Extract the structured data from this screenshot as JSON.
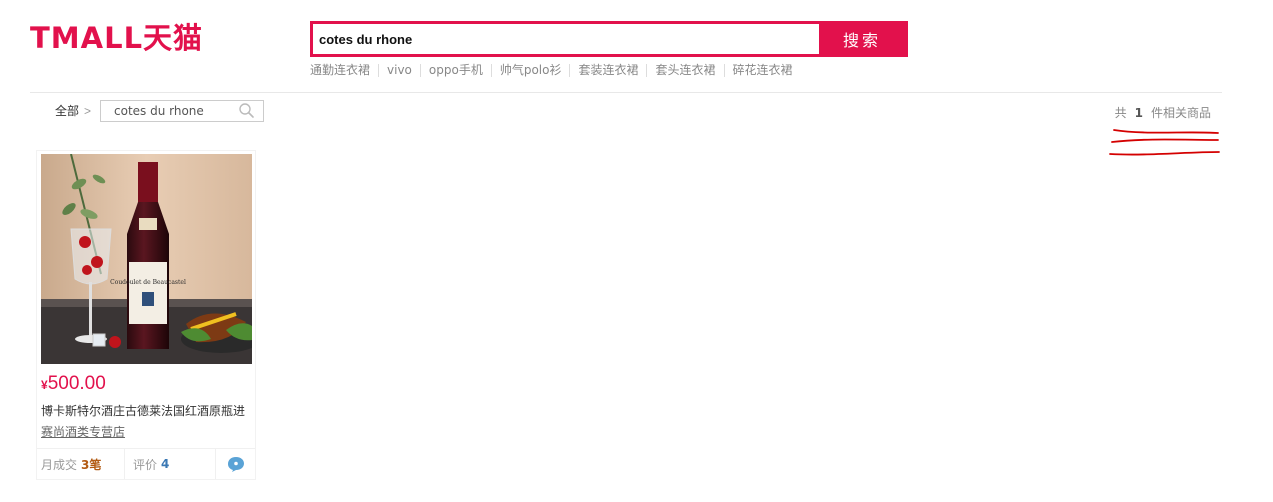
{
  "logo": {
    "text": "TMALL天猫",
    "color": "#e2114c"
  },
  "search": {
    "value": "cotes du rhone",
    "placeholder": "",
    "button_label": "搜索"
  },
  "hotwords": [
    "通勤连衣裙",
    "vivo",
    "oppo手机",
    "帅气polo衫",
    "套装连衣裙",
    "套头连衣裙",
    "碎花连衣裙"
  ],
  "breadcrumb": {
    "all_label": "全部",
    "arrow": ">",
    "current": "cotes du rhone"
  },
  "result_count": {
    "prefix": "共",
    "count": "1",
    "suffix": "件相关商品"
  },
  "product": {
    "price_symbol": "¥",
    "price": "500.00",
    "title": "博卡斯特尔酒庄古德莱法国红酒原瓶进",
    "shop": "赛尚酒类专营店",
    "sales_label": "月成交",
    "sales_value": "3笔",
    "reviews_label": "评价",
    "reviews_value": "4",
    "chat_icon": "wangwang-chat-icon"
  },
  "colors": {
    "accent": "#e2114c",
    "annotation": "#d40000"
  }
}
